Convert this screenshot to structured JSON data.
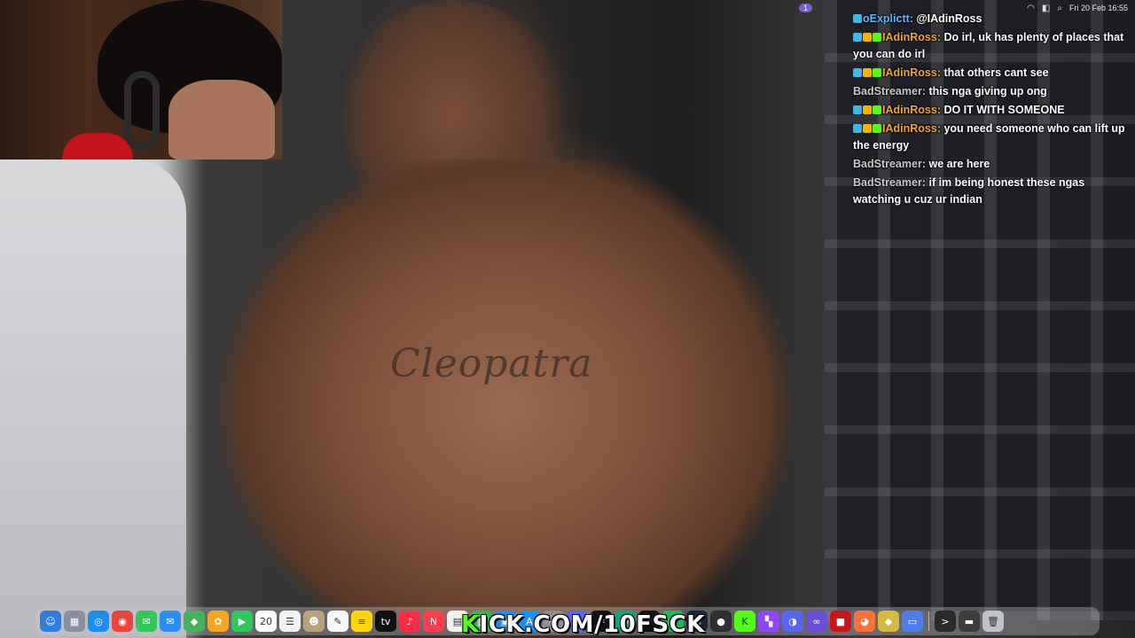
{
  "menubar": {
    "pill": "1",
    "clock": "Fri 20 Feb  16:55"
  },
  "chat": [
    {
      "user": "oExplictt",
      "user_color": "blue",
      "badges": [
        "b1"
      ],
      "text": "@IAdinRoss"
    },
    {
      "user": "IAdinRoss",
      "user_color": "orange",
      "badges": [
        "b1",
        "b2",
        "b3"
      ],
      "text": "Do irl, uk has plenty of places that you can do irl"
    },
    {
      "user": "IAdinRoss",
      "user_color": "orange",
      "badges": [
        "b1",
        "b2",
        "b3"
      ],
      "text": "that others cant see"
    },
    {
      "user": "BadStreamer",
      "user_color": "gray",
      "badges": [],
      "text": "this nga giving up ong"
    },
    {
      "user": "IAdinRoss",
      "user_color": "orange",
      "badges": [
        "b1",
        "b2",
        "b3"
      ],
      "text": "DO IT WITH SOMEONE"
    },
    {
      "user": "IAdinRoss",
      "user_color": "orange",
      "badges": [
        "b1",
        "b2",
        "b3"
      ],
      "text": "you need someone who can lift up the energy"
    },
    {
      "user": "BadStreamer",
      "user_color": "gray",
      "badges": [],
      "text": "we are here"
    },
    {
      "user": "BadStreamer",
      "user_color": "gray",
      "badges": [],
      "text": "if im being honest these ngas watching u cuz ur indian"
    }
  ],
  "tattoo_text": "Cleopatra",
  "watermark": {
    "k": "K",
    "rest": "ICK.COM/10FSCK"
  },
  "dock": [
    {
      "name": "finder-icon",
      "color": "#2f7de1",
      "glyph": "☺"
    },
    {
      "name": "launchpad-icon",
      "color": "#8a8fa0",
      "glyph": "▦"
    },
    {
      "name": "safari-icon",
      "color": "#1f8cf0",
      "glyph": "◎"
    },
    {
      "name": "chrome-icon",
      "color": "#e8453c",
      "glyph": "◉"
    },
    {
      "name": "messages-icon",
      "color": "#34c759",
      "glyph": "✉"
    },
    {
      "name": "mail-icon",
      "color": "#2b8cf3",
      "glyph": "✉"
    },
    {
      "name": "maps-icon",
      "color": "#45b35a",
      "glyph": "◆"
    },
    {
      "name": "photos-icon",
      "color": "#f5a623",
      "glyph": "✿"
    },
    {
      "name": "facetime-icon",
      "color": "#30c85a",
      "glyph": "▶"
    },
    {
      "name": "calendar-icon",
      "color": "#ffffff",
      "glyph": "20"
    },
    {
      "name": "reminders-icon",
      "color": "#f2f2f2",
      "glyph": "☰"
    },
    {
      "name": "contacts-icon",
      "color": "#b8a27a",
      "glyph": "☻"
    },
    {
      "name": "freeform-icon",
      "color": "#f8f8f8",
      "glyph": "✎"
    },
    {
      "name": "notes-icon",
      "color": "#ffd60a",
      "glyph": "≡"
    },
    {
      "name": "appletv-icon",
      "color": "#111111",
      "glyph": "tv"
    },
    {
      "name": "music-icon",
      "color": "#fa2d48",
      "glyph": "♪"
    },
    {
      "name": "news-icon",
      "color": "#fa3f4f",
      "glyph": "N"
    },
    {
      "name": "pages-icon",
      "color": "#f0f0f0",
      "glyph": "▤"
    },
    {
      "name": "numbers-icon",
      "color": "#2fb84c",
      "glyph": "▥"
    },
    {
      "name": "keynote-icon",
      "color": "#1f8cf0",
      "glyph": "▣"
    },
    {
      "name": "appstore-icon",
      "color": "#1c8ef5",
      "glyph": "A"
    },
    {
      "name": "settings-icon",
      "color": "#8e8e93",
      "glyph": "⚙"
    },
    {
      "name": "discord-icon",
      "color": "#5865f2",
      "glyph": "◐"
    },
    {
      "name": "capcut-icon",
      "color": "#111111",
      "glyph": "✂"
    },
    {
      "name": "chatgpt-icon",
      "color": "#10a37f",
      "glyph": "✺"
    },
    {
      "name": "tiktok-icon",
      "color": "#111111",
      "glyph": "♪"
    },
    {
      "name": "spotify-icon",
      "color": "#1db954",
      "glyph": "≋"
    },
    {
      "name": "steam-icon",
      "color": "#1b2838",
      "glyph": "◍"
    },
    {
      "name": "obs-icon",
      "color": "#302e31",
      "glyph": "●"
    },
    {
      "name": "kick-icon",
      "color": "#53fc18",
      "glyph": "K"
    },
    {
      "name": "twitch-icon",
      "color": "#9146ff",
      "glyph": "▚"
    },
    {
      "name": "discord-alt-icon",
      "color": "#5865f2",
      "glyph": "◑"
    },
    {
      "name": "vpn-icon",
      "color": "#6b4ed6",
      "glyph": "∞"
    },
    {
      "name": "game-icon",
      "color": "#c9141b",
      "glyph": "■"
    },
    {
      "name": "firefox-icon",
      "color": "#ff7139",
      "glyph": "◕"
    },
    {
      "name": "store-icon",
      "color": "#d8b840",
      "glyph": "◆"
    },
    {
      "name": "preview-icon",
      "color": "#4d7ee8",
      "glyph": "▭"
    },
    {
      "name": "terminal-icon",
      "color": "#2b2b2b",
      "glyph": ">"
    },
    {
      "name": "downloads-icon",
      "color": "#3b3b3b",
      "glyph": "▬"
    },
    {
      "name": "trash-icon",
      "color": "#bfc3c8",
      "glyph": "🗑"
    }
  ]
}
